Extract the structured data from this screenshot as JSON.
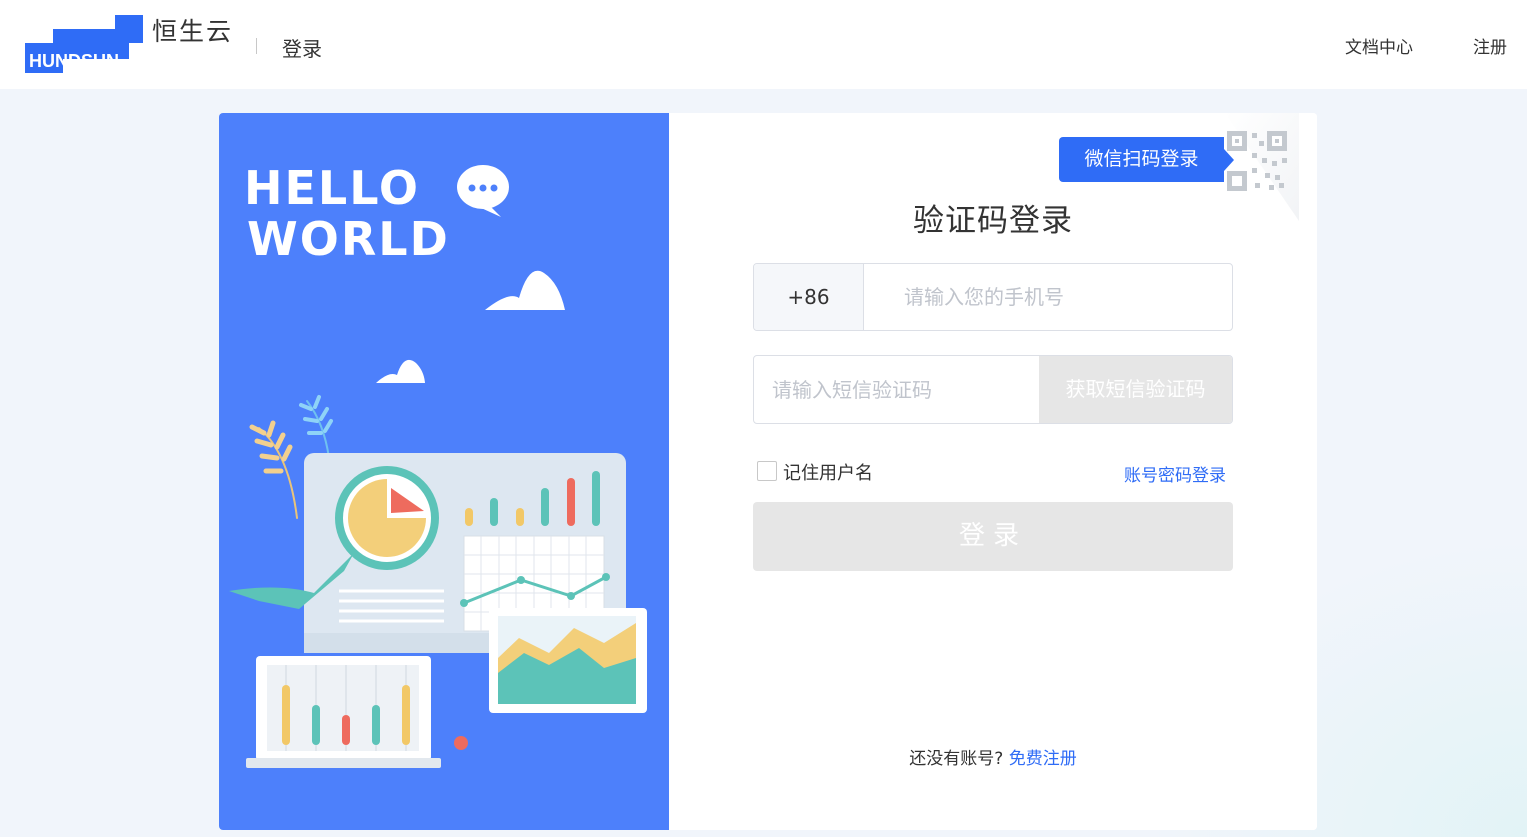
{
  "header": {
    "logo_text": "HUNDSUN",
    "brand_name": "恒生云",
    "page_label": "登录",
    "nav": {
      "docs": "文档中心",
      "register": "注册"
    }
  },
  "illustration": {
    "headline_line1": "HELLO",
    "headline_line2": "WORLD"
  },
  "login": {
    "wechat_tag": "微信扫码登录",
    "title": "验证码登录",
    "phone_prefix": "+86",
    "phone_placeholder": "请输入您的手机号",
    "phone_value": "",
    "sms_placeholder": "请输入短信验证码",
    "sms_value": "",
    "sms_button": "获取短信验证码",
    "remember_label": "记住用户名",
    "remember_checked": false,
    "password_login_link": "账号密码登录",
    "submit": "登录",
    "no_account_text": "还没有账号?",
    "free_register_link": "免费注册"
  },
  "colors": {
    "accent": "#2f6cf6",
    "panel_blue": "#4d80fb",
    "disabled_button": "#e6e6e6"
  }
}
